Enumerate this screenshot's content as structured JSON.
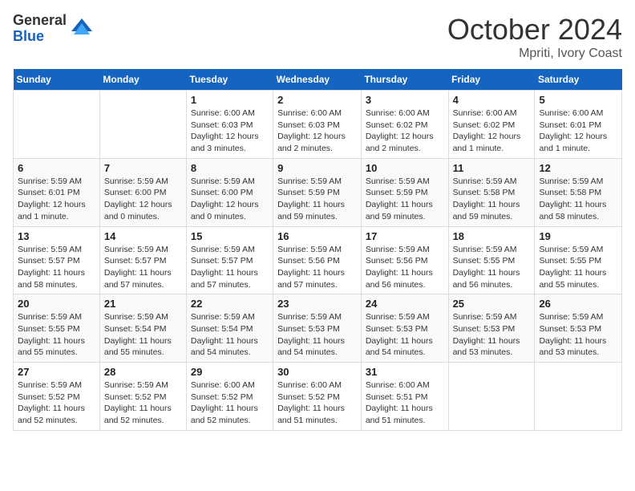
{
  "logo": {
    "general": "General",
    "blue": "Blue"
  },
  "title": "October 2024",
  "location": "Mpriti, Ivory Coast",
  "days_of_week": [
    "Sunday",
    "Monday",
    "Tuesday",
    "Wednesday",
    "Thursday",
    "Friday",
    "Saturday"
  ],
  "weeks": [
    [
      {
        "num": "",
        "info": ""
      },
      {
        "num": "",
        "info": ""
      },
      {
        "num": "1",
        "info": "Sunrise: 6:00 AM\nSunset: 6:03 PM\nDaylight: 12 hours and 3 minutes."
      },
      {
        "num": "2",
        "info": "Sunrise: 6:00 AM\nSunset: 6:03 PM\nDaylight: 12 hours and 2 minutes."
      },
      {
        "num": "3",
        "info": "Sunrise: 6:00 AM\nSunset: 6:02 PM\nDaylight: 12 hours and 2 minutes."
      },
      {
        "num": "4",
        "info": "Sunrise: 6:00 AM\nSunset: 6:02 PM\nDaylight: 12 hours and 1 minute."
      },
      {
        "num": "5",
        "info": "Sunrise: 6:00 AM\nSunset: 6:01 PM\nDaylight: 12 hours and 1 minute."
      }
    ],
    [
      {
        "num": "6",
        "info": "Sunrise: 5:59 AM\nSunset: 6:01 PM\nDaylight: 12 hours and 1 minute."
      },
      {
        "num": "7",
        "info": "Sunrise: 5:59 AM\nSunset: 6:00 PM\nDaylight: 12 hours and 0 minutes."
      },
      {
        "num": "8",
        "info": "Sunrise: 5:59 AM\nSunset: 6:00 PM\nDaylight: 12 hours and 0 minutes."
      },
      {
        "num": "9",
        "info": "Sunrise: 5:59 AM\nSunset: 5:59 PM\nDaylight: 11 hours and 59 minutes."
      },
      {
        "num": "10",
        "info": "Sunrise: 5:59 AM\nSunset: 5:59 PM\nDaylight: 11 hours and 59 minutes."
      },
      {
        "num": "11",
        "info": "Sunrise: 5:59 AM\nSunset: 5:58 PM\nDaylight: 11 hours and 59 minutes."
      },
      {
        "num": "12",
        "info": "Sunrise: 5:59 AM\nSunset: 5:58 PM\nDaylight: 11 hours and 58 minutes."
      }
    ],
    [
      {
        "num": "13",
        "info": "Sunrise: 5:59 AM\nSunset: 5:57 PM\nDaylight: 11 hours and 58 minutes."
      },
      {
        "num": "14",
        "info": "Sunrise: 5:59 AM\nSunset: 5:57 PM\nDaylight: 11 hours and 57 minutes."
      },
      {
        "num": "15",
        "info": "Sunrise: 5:59 AM\nSunset: 5:57 PM\nDaylight: 11 hours and 57 minutes."
      },
      {
        "num": "16",
        "info": "Sunrise: 5:59 AM\nSunset: 5:56 PM\nDaylight: 11 hours and 57 minutes."
      },
      {
        "num": "17",
        "info": "Sunrise: 5:59 AM\nSunset: 5:56 PM\nDaylight: 11 hours and 56 minutes."
      },
      {
        "num": "18",
        "info": "Sunrise: 5:59 AM\nSunset: 5:55 PM\nDaylight: 11 hours and 56 minutes."
      },
      {
        "num": "19",
        "info": "Sunrise: 5:59 AM\nSunset: 5:55 PM\nDaylight: 11 hours and 55 minutes."
      }
    ],
    [
      {
        "num": "20",
        "info": "Sunrise: 5:59 AM\nSunset: 5:55 PM\nDaylight: 11 hours and 55 minutes."
      },
      {
        "num": "21",
        "info": "Sunrise: 5:59 AM\nSunset: 5:54 PM\nDaylight: 11 hours and 55 minutes."
      },
      {
        "num": "22",
        "info": "Sunrise: 5:59 AM\nSunset: 5:54 PM\nDaylight: 11 hours and 54 minutes."
      },
      {
        "num": "23",
        "info": "Sunrise: 5:59 AM\nSunset: 5:53 PM\nDaylight: 11 hours and 54 minutes."
      },
      {
        "num": "24",
        "info": "Sunrise: 5:59 AM\nSunset: 5:53 PM\nDaylight: 11 hours and 54 minutes."
      },
      {
        "num": "25",
        "info": "Sunrise: 5:59 AM\nSunset: 5:53 PM\nDaylight: 11 hours and 53 minutes."
      },
      {
        "num": "26",
        "info": "Sunrise: 5:59 AM\nSunset: 5:53 PM\nDaylight: 11 hours and 53 minutes."
      }
    ],
    [
      {
        "num": "27",
        "info": "Sunrise: 5:59 AM\nSunset: 5:52 PM\nDaylight: 11 hours and 52 minutes."
      },
      {
        "num": "28",
        "info": "Sunrise: 5:59 AM\nSunset: 5:52 PM\nDaylight: 11 hours and 52 minutes."
      },
      {
        "num": "29",
        "info": "Sunrise: 6:00 AM\nSunset: 5:52 PM\nDaylight: 11 hours and 52 minutes."
      },
      {
        "num": "30",
        "info": "Sunrise: 6:00 AM\nSunset: 5:52 PM\nDaylight: 11 hours and 51 minutes."
      },
      {
        "num": "31",
        "info": "Sunrise: 6:00 AM\nSunset: 5:51 PM\nDaylight: 11 hours and 51 minutes."
      },
      {
        "num": "",
        "info": ""
      },
      {
        "num": "",
        "info": ""
      }
    ]
  ]
}
